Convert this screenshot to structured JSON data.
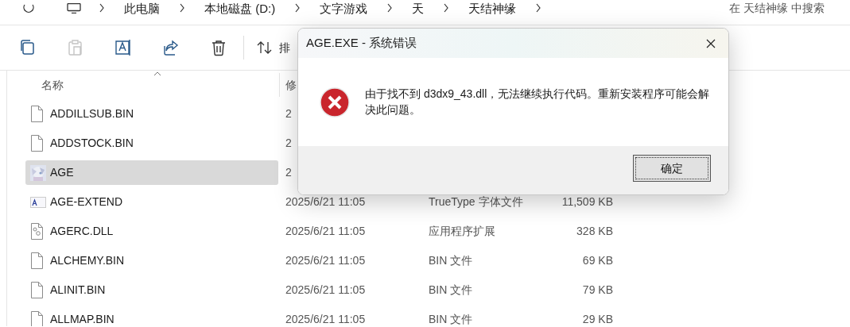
{
  "breadcrumbs": [
    "此电脑",
    "本地磁盘 (D:)",
    "文字游戏",
    "天",
    "天结神缘"
  ],
  "search": {
    "placeholder": "在 天结神缘 中搜索"
  },
  "toolbar": {
    "buttons": [
      {
        "kind": "copy",
        "disabled": false
      },
      {
        "kind": "paste",
        "disabled": true
      },
      {
        "kind": "rename",
        "disabled": false
      },
      {
        "kind": "share",
        "disabled": false
      },
      {
        "kind": "delete",
        "disabled": false
      }
    ],
    "sort_label": "排"
  },
  "columns": [
    "名称",
    "修"
  ],
  "rows": [
    {
      "name": "ADDILLSUB.BIN",
      "kind": "file",
      "date": "2",
      "selected": false
    },
    {
      "name": "ADDSTOCK.BIN",
      "kind": "file",
      "date": "2",
      "selected": false
    },
    {
      "name": "AGE",
      "kind": "app",
      "date": "2",
      "selected": true
    },
    {
      "name": "AGE-EXTEND",
      "kind": "font",
      "date": "2025/6/21 11:05",
      "type": "TrueType 字体文件",
      "size": "11,509 KB",
      "selected": false
    },
    {
      "name": "AGERC.DLL",
      "kind": "dll",
      "date": "2025/6/21 11:05",
      "type": "应用程序扩展",
      "size": "328 KB",
      "selected": false
    },
    {
      "name": "ALCHEMY.BIN",
      "kind": "file",
      "date": "2025/6/21 11:05",
      "type": "BIN 文件",
      "size": "69 KB",
      "selected": false
    },
    {
      "name": "ALINIT.BIN",
      "kind": "file",
      "date": "2025/6/21 11:05",
      "type": "BIN 文件",
      "size": "79 KB",
      "selected": false
    },
    {
      "name": "ALLMAP.BIN",
      "kind": "file",
      "date": "2025/6/21 11:05",
      "type": "BIN 文件",
      "size": "29 KB",
      "selected": false
    }
  ],
  "dialog": {
    "title": "AGE.EXE - 系统错误",
    "message": "由于找不到 d3dx9_43.dll，无法继续执行代码。重新安装程序可能会解决此问题。",
    "buttons": [
      "确定"
    ]
  }
}
